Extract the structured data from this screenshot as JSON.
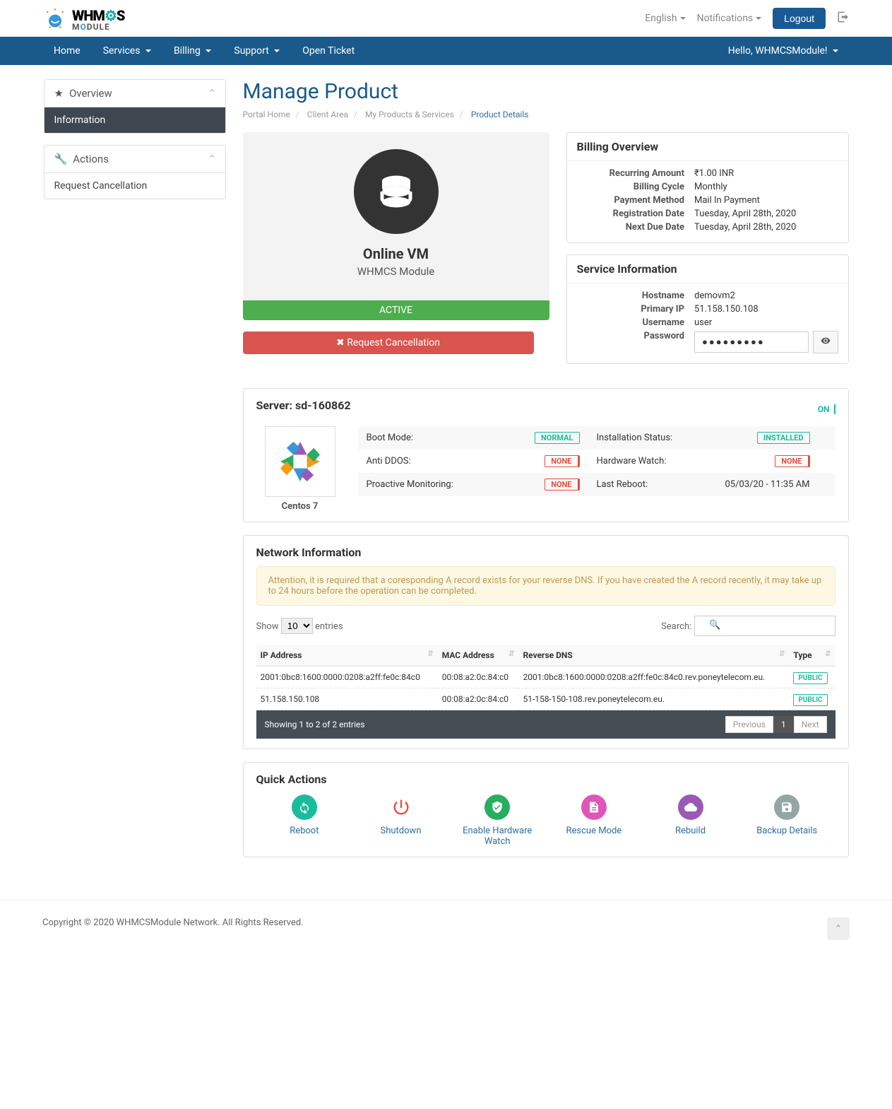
{
  "header": {
    "language": "English",
    "notifications": "Notifications",
    "logout": "Logout"
  },
  "nav": {
    "home": "Home",
    "services": "Services",
    "billing": "Billing",
    "support": "Support",
    "open_ticket": "Open Ticket",
    "hello": "Hello, WHMCSModule!"
  },
  "sidebar": {
    "overview": "Overview",
    "information": "Information",
    "actions": "Actions",
    "request_cancel": "Request Cancellation"
  },
  "page": {
    "title": "Manage Product",
    "breadcrumb": {
      "home": "Portal Home",
      "client": "Client Area",
      "products": "My Products & Services",
      "current": "Product Details"
    }
  },
  "product": {
    "name": "Online VM",
    "subtitle": "WHMCS Module",
    "status": "ACTIVE",
    "cancel_btn": "Request Cancellation"
  },
  "billing": {
    "title": "Billing Overview",
    "recurring_label": "Recurring Amount",
    "recurring": "₹1.00 INR",
    "cycle_label": "Billing Cycle",
    "cycle": "Monthly",
    "method_label": "Payment Method",
    "method": "Mail In Payment",
    "reg_label": "Registration Date",
    "reg": "Tuesday, April 28th, 2020",
    "due_label": "Next Due Date",
    "due": "Tuesday, April 28th, 2020"
  },
  "service": {
    "title": "Service Information",
    "hostname_label": "Hostname",
    "hostname": "demovm2",
    "ip_label": "Primary IP",
    "ip": "51.158.150.108",
    "user_label": "Username",
    "user": "user",
    "pwd_label": "Password",
    "pwd_mask": "●●●●●●●●●"
  },
  "server": {
    "title": "Server: sd-160862",
    "on": "ON",
    "os": "Centos 7",
    "boot_label": "Boot Mode:",
    "boot": "NORMAL",
    "install_label": "Installation Status:",
    "install": "INSTALLED",
    "ddos_label": "Anti DDOS:",
    "ddos": "NONE",
    "hw_label": "Hardware Watch:",
    "hw": "NONE",
    "mon_label": "Proactive Monitoring:",
    "mon": "NONE",
    "reboot_label": "Last Reboot:",
    "reboot": "05/03/20 - 11:35 AM"
  },
  "network": {
    "title": "Network Information",
    "alert": "Attention, it is required that a coresponding A record exists for your reverse DNS. If you have created the A record recently, it may take up to 24 hours before the operation can be completed.",
    "show": "Show",
    "entries": "entries",
    "page_size": "10",
    "search_label": "Search:",
    "cols": {
      "ip": "IP Address",
      "mac": "MAC Address",
      "rdns": "Reverse DNS",
      "type": "Type"
    },
    "rows": [
      {
        "ip": "2001:0bc8:1600:0000:0208:a2ff:fe0c:84c0",
        "mac": "00:08:a2:0c:84:c0",
        "rdns": "2001:0bc8:1600:0000:0208:a2ff:fe0c:84c0.rev.poneytelecom.eu.",
        "type": "PUBLIC"
      },
      {
        "ip": "51.158.150.108",
        "mac": "00:08:a2:0c:84:c0",
        "rdns": "51-158-150-108.rev.poneytelecom.eu.",
        "type": "PUBLIC"
      }
    ],
    "info": "Showing 1 to 2 of 2 entries",
    "prev": "Previous",
    "page1": "1",
    "next": "Next"
  },
  "qa": {
    "title": "Quick Actions",
    "reboot": "Reboot",
    "shutdown": "Shutdown",
    "hw_watch": "Enable Hardware Watch",
    "rescue": "Rescue Mode",
    "rebuild": "Rebuild",
    "backup": "Backup Details"
  },
  "footer": {
    "copyright": "Copyright © 2020 WHMCSModule Network. All Rights Reserved."
  }
}
